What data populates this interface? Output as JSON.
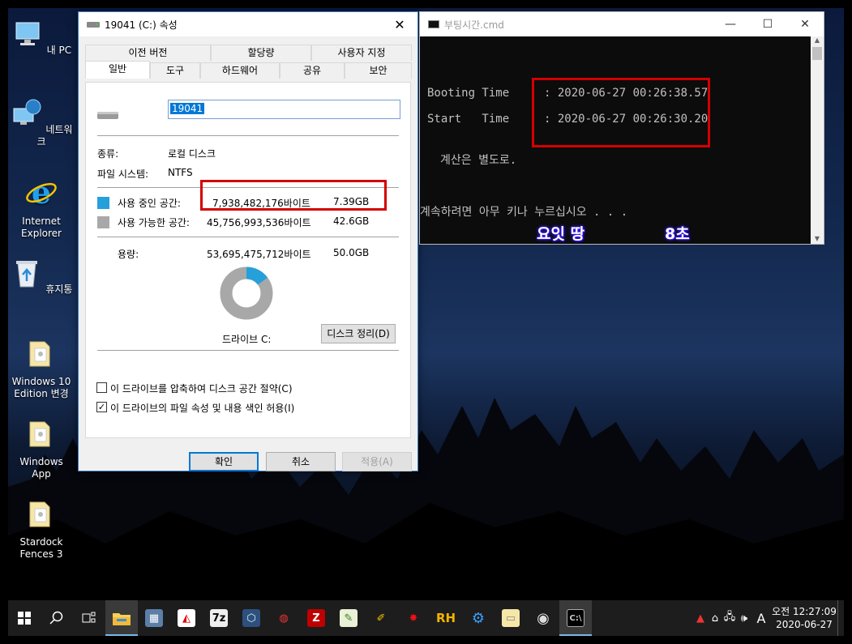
{
  "desktop_icons": [
    {
      "label": "내 PC",
      "icon": "computer-icon"
    },
    {
      "label": "네트워크",
      "icon": "network-icon"
    },
    {
      "label": "Internet Explorer",
      "icon": "internet-explorer-icon"
    },
    {
      "label": "휴지통",
      "icon": "recycle-bin-icon"
    },
    {
      "label": "Windows 10 Edition 변경",
      "icon": "folder-icon"
    },
    {
      "label": "Windows App",
      "icon": "folder-icon"
    },
    {
      "label": "Stardock Fences 3",
      "icon": "folder-icon"
    }
  ],
  "dialog": {
    "title": "19041 (C:) 속성",
    "tabs_top": [
      "이전 버전",
      "할당량",
      "사용자 지정"
    ],
    "tabs_bottom": [
      "일반",
      "도구",
      "하드웨어",
      "공유",
      "보안"
    ],
    "drive_name": "19041",
    "type_label": "종류:",
    "type_value": "로컬 디스크",
    "fs_label": "파일 시스템:",
    "fs_value": "NTFS",
    "used_label": "사용 중인 공간:",
    "used_bytes": "7,938,482,176바이트",
    "used_gb": "7.39GB",
    "free_label": "사용 가능한 공간:",
    "free_bytes": "45,756,993,536바이트",
    "free_gb": "42.6GB",
    "capacity_label": "용량:",
    "capacity_bytes": "53,695,475,712바이트",
    "capacity_gb": "50.0GB",
    "used_fraction": 0.148,
    "drive_label": "드라이브 C:",
    "cleanup_button": "디스크 정리(D)",
    "compress_label": "이 드라이브를 압축하여 디스크 공간 절약(C)",
    "compress_checked": false,
    "index_label": "이 드라이브의 파일 속성 및 내용 색인 허용(I)",
    "index_checked": true,
    "ok_button": "확인",
    "cancel_button": "취소",
    "apply_button": "적용(A)",
    "used_color": "#26a0da",
    "free_color": "#a8a8a8"
  },
  "cmd": {
    "title": "부팅시간.cmd",
    "booting_label": "Booting Time",
    "booting_value": ": 2020-06-27 00:26:38.57",
    "start_label": "Start   Time",
    "start_value": ": 2020-06-27 00:26:30.20",
    "note": "계산은 별도로.",
    "continue": "계속하려면 아무 키나 누르십시오 . . .",
    "overlay_left": "요잇 땅",
    "overlay_right": "8초"
  },
  "taskbar": {
    "apps": [
      {
        "icon": "start-icon"
      },
      {
        "icon": "search-icon"
      },
      {
        "icon": "task-view-icon"
      },
      {
        "icon": "file-explorer-icon",
        "active": true
      },
      {
        "icon": "calculator-icon"
      },
      {
        "icon": "app-icon"
      },
      {
        "icon": "7zip-icon",
        "label": "7z"
      },
      {
        "icon": "virtualbox-icon"
      },
      {
        "icon": "app-icon"
      },
      {
        "icon": "filezilla-icon",
        "label": "Z"
      },
      {
        "icon": "notepad-icon"
      },
      {
        "icon": "editor-icon"
      },
      {
        "icon": "app-icon"
      },
      {
        "icon": "resource-hacker-icon",
        "label": "RH"
      },
      {
        "icon": "settings-icon"
      },
      {
        "icon": "folder-icon"
      },
      {
        "icon": "media-icon"
      },
      {
        "icon": "cmd-icon",
        "active": true
      }
    ],
    "tray_ime": "A",
    "clock_time": "오전 12:27:09",
    "clock_date": "2020-06-27"
  }
}
